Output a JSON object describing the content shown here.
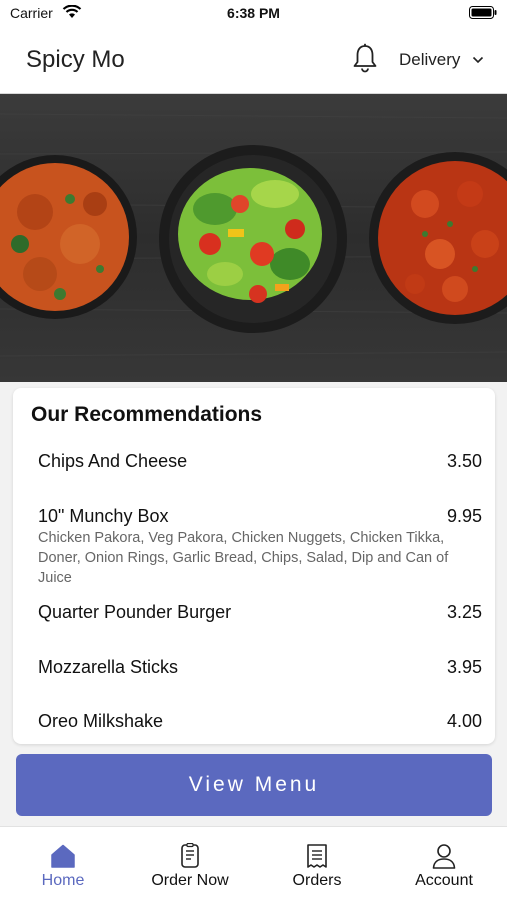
{
  "status_bar": {
    "carrier": "Carrier",
    "time": "6:38 PM"
  },
  "header": {
    "title": "Spicy Mo",
    "mode": "Delivery"
  },
  "recommendations": {
    "title": "Our Recommendations",
    "items": [
      {
        "name": "Chips And Cheese",
        "price": "3.50",
        "description": ""
      },
      {
        "name": "10\" Munchy Box",
        "price": "9.95",
        "description": "Chicken Pakora, Veg Pakora, Chicken Nuggets, Chicken Tikka, Doner, Onion Rings, Garlic Bread, Chips, Salad, Dip and Can of Juice"
      },
      {
        "name": "Quarter Pounder Burger",
        "price": "3.25",
        "description": ""
      },
      {
        "name": "Mozzarella Sticks",
        "price": "3.95",
        "description": ""
      },
      {
        "name": "Oreo Milkshake",
        "price": "4.00",
        "description": ""
      }
    ]
  },
  "view_menu_label": "View Menu",
  "tabs": [
    {
      "label": "Home",
      "icon": "home-icon",
      "active": true
    },
    {
      "label": "Order Now",
      "icon": "order-icon",
      "active": false
    },
    {
      "label": "Orders",
      "icon": "receipt-icon",
      "active": false
    },
    {
      "label": "Account",
      "icon": "person-icon",
      "active": false
    }
  ],
  "colors": {
    "accent": "#5b69bf",
    "background": "#f2f2f2",
    "card": "#ffffff"
  }
}
